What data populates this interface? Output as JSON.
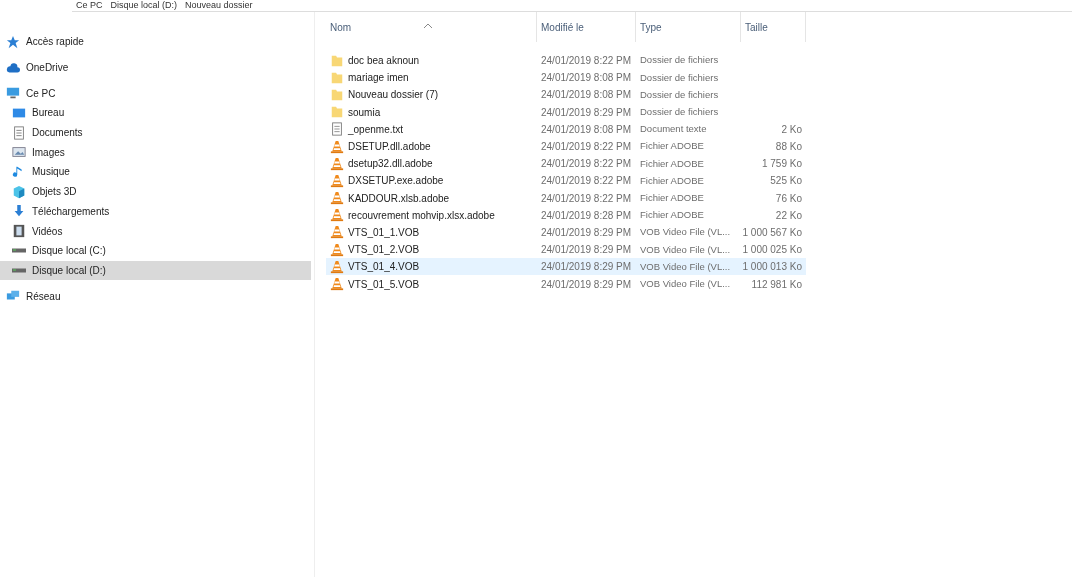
{
  "breadcrumb": [
    "Ce PC",
    "Disque local (D:)",
    "Nouveau dossier"
  ],
  "sidebar": {
    "items": [
      {
        "label": "Accès rapide",
        "selected": false
      },
      {
        "label": "OneDrive",
        "selected": false
      },
      {
        "label": "Ce PC",
        "selected": false,
        "children": [
          {
            "label": "Bureau",
            "selected": false
          },
          {
            "label": "Documents",
            "selected": false
          },
          {
            "label": "Images",
            "selected": false
          },
          {
            "label": "Musique",
            "selected": false
          },
          {
            "label": "Objets 3D",
            "selected": false
          },
          {
            "label": "Téléchargements",
            "selected": false
          },
          {
            "label": "Vidéos",
            "selected": false
          },
          {
            "label": "Disque local (C:)",
            "selected": false
          },
          {
            "label": "Disque local (D:)",
            "selected": true
          }
        ]
      },
      {
        "label": "Réseau",
        "selected": false
      }
    ]
  },
  "table": {
    "columns": [
      "Nom",
      "Modifié le",
      "Type",
      "Taille"
    ],
    "rows": [
      {
        "kind": "folder",
        "name": "doc bea aknoun",
        "modified": "24/01/2019 8:22 PM",
        "type": "Dossier de fichiers",
        "size": "",
        "highlighted": false
      },
      {
        "kind": "folder",
        "name": "mariage imen",
        "modified": "24/01/2019 8:08 PM",
        "type": "Dossier de fichiers",
        "size": "",
        "highlighted": false
      },
      {
        "kind": "folder",
        "name": "Nouveau dossier (7)",
        "modified": "24/01/2019 8:08 PM",
        "type": "Dossier de fichiers",
        "size": "",
        "highlighted": false
      },
      {
        "kind": "folder",
        "name": "soumia",
        "modified": "24/01/2019 8:29 PM",
        "type": "Dossier de fichiers",
        "size": "",
        "highlighted": false
      },
      {
        "kind": "text",
        "name": "_openme.txt",
        "modified": "24/01/2019 8:08 PM",
        "type": "Document texte",
        "size": "2 Ko",
        "highlighted": false
      },
      {
        "kind": "media",
        "name": "DSETUP.dll.adobe",
        "modified": "24/01/2019 8:22 PM",
        "type": "Fichier ADOBE",
        "size": "88 Ko",
        "highlighted": false
      },
      {
        "kind": "media",
        "name": "dsetup32.dll.adobe",
        "modified": "24/01/2019 8:22 PM",
        "type": "Fichier ADOBE",
        "size": "1 759 Ko",
        "highlighted": false
      },
      {
        "kind": "media",
        "name": "DXSETUP.exe.adobe",
        "modified": "24/01/2019 8:22 PM",
        "type": "Fichier ADOBE",
        "size": "525 Ko",
        "highlighted": false
      },
      {
        "kind": "media",
        "name": "KADDOUR.xlsb.adobe",
        "modified": "24/01/2019 8:22 PM",
        "type": "Fichier ADOBE",
        "size": "76 Ko",
        "highlighted": false
      },
      {
        "kind": "media",
        "name": "recouvrement mohvip.xlsx.adobe",
        "modified": "24/01/2019 8:28 PM",
        "type": "Fichier ADOBE",
        "size": "22 Ko",
        "highlighted": false
      },
      {
        "kind": "media",
        "name": "VTS_01_1.VOB",
        "modified": "24/01/2019 8:29 PM",
        "type": "VOB Video File (VL...",
        "size": "1 000 567 Ko",
        "highlighted": false
      },
      {
        "kind": "media",
        "name": "VTS_01_2.VOB",
        "modified": "24/01/2019 8:29 PM",
        "type": "VOB Video File (VL...",
        "size": "1 000 025 Ko",
        "highlighted": false
      },
      {
        "kind": "media",
        "name": "VTS_01_4.VOB",
        "modified": "24/01/2019 8:29 PM",
        "type": "VOB Video File (VL...",
        "size": "1 000 013 Ko",
        "highlighted": true
      },
      {
        "kind": "media",
        "name": "VTS_01_5.VOB",
        "modified": "24/01/2019 8:29 PM",
        "type": "VOB Video File (VL...",
        "size": "112 981 Ko",
        "highlighted": false
      }
    ]
  }
}
